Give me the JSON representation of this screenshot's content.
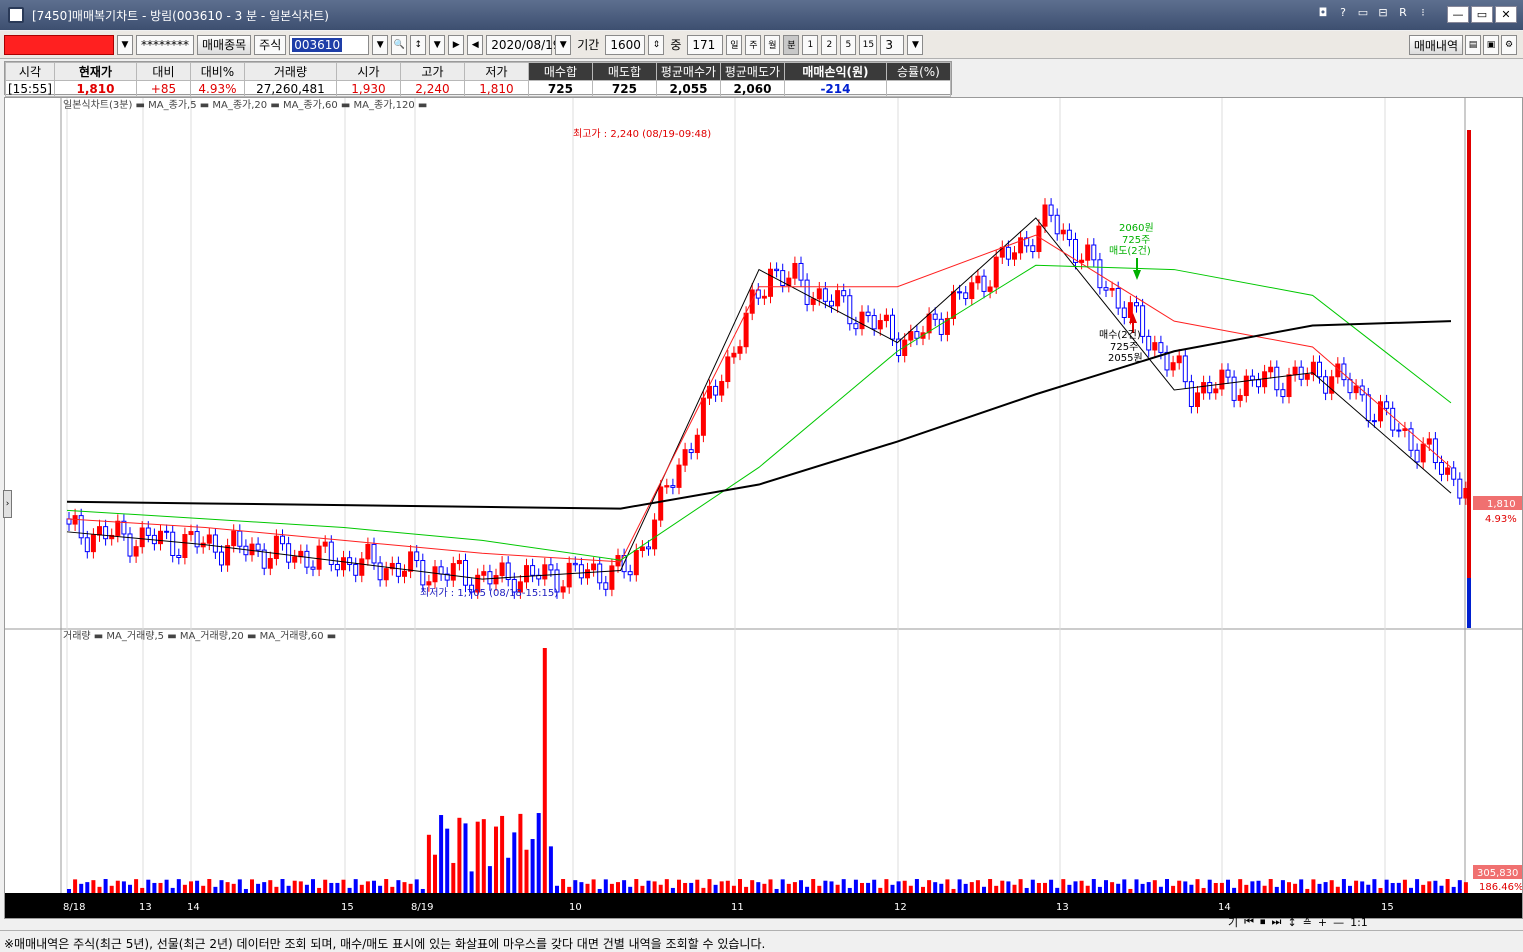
{
  "window": {
    "title": "[7450]매매복기차트 - 방림(003610 - 3 분 - 일본식차트)",
    "controls": [
      "◘",
      "?",
      "▭",
      "⊟",
      "R",
      "⁝"
    ],
    "buttons": [
      "—",
      "▭",
      "✕"
    ]
  },
  "toolbar": {
    "account_masked": "********",
    "trade_items_label": "매매종목",
    "market_label": "주식",
    "code": "003610",
    "date": "2020/08/19",
    "period_label": "기간",
    "period_value": "1600",
    "count_label": "중",
    "count_value": "171",
    "interval_buttons": [
      "일",
      "주",
      "월",
      "분",
      "1",
      "2",
      "5",
      "15"
    ],
    "selected_interval": "분",
    "minute_value": "3",
    "trade_history_label": "매매내역"
  },
  "summary": {
    "headers": [
      "시각",
      "현재가",
      "대비",
      "대비%",
      "거래량",
      "시가",
      "고가",
      "저가",
      "매수합",
      "매도합",
      "평균매수가",
      "평균매도가",
      "매매손익(원)",
      "승률(%)"
    ],
    "values": [
      "[15:55]",
      "1,810",
      "+85",
      "4.93%",
      "27,260,481",
      "1,930",
      "2,240",
      "1,810",
      "725",
      "725",
      "2,055",
      "2,060",
      "-214",
      ""
    ]
  },
  "chart": {
    "price_legend": "일본식차트(3분) ▬ MA_종가,5 ▬ MA_종가,20 ▬ MA_종가,60 ▬ MA_종가,120 ▬",
    "volume_legend": "거래량 ▬ MA_거래량,5 ▬ MA_거래량,20 ▬ MA_거래량,60 ▬",
    "high_label": "최고가 : 2,240 (08/19-09:48)",
    "low_label": "최저가 : 1,705 (08/18-15:15)",
    "buy_marker": [
      "매수(2건)",
      "725주",
      "2055원"
    ],
    "sell_marker": [
      "2060원",
      "725주",
      "매도(2건)"
    ],
    "price_tag": "1,810",
    "price_tag_pct": "4.93%",
    "volume_tag": "305,830",
    "volume_tag_pct": "186.46%",
    "x_labels": [
      "8/18",
      "13",
      "14",
      "15",
      "8/19",
      "10",
      "11",
      "12",
      "13",
      "14",
      "15"
    ],
    "colors": {
      "up": "#ff0000",
      "down": "#0000ff",
      "ma5": "#000000",
      "ma20": "#ff2020",
      "ma60": "#00c800",
      "ma120": "#000000"
    }
  },
  "chart_data": {
    "type": "candlestick",
    "title": "일본식차트(3분)",
    "x": [
      "8/18",
      "13",
      "14",
      "15",
      "8/19",
      "10",
      "11",
      "12",
      "13",
      "14",
      "15"
    ],
    "ylim": [
      1705,
      2240
    ],
    "series": [
      {
        "name": "MA_종가,5",
        "values": [
          1775,
          1760,
          1740,
          1720,
          1730,
          2080,
          1995,
          2140,
          1940,
          1960,
          1820
        ]
      },
      {
        "name": "MA_종가,20",
        "values": [
          1790,
          1780,
          1765,
          1750,
          1740,
          2060,
          2060,
          2120,
          2020,
          1990,
          1850
        ]
      },
      {
        "name": "MA_종가,60",
        "values": [
          1800,
          1790,
          1780,
          1765,
          1742,
          1850,
          1985,
          2085,
          2080,
          2050,
          1925
        ]
      },
      {
        "name": "MA_종가,120",
        "values": [
          1810,
          1808,
          1806,
          1804,
          1802,
          1830,
          1880,
          1935,
          1985,
          2015,
          2020
        ]
      }
    ],
    "volume": {
      "name": "거래량",
      "peak": 305830
    }
  },
  "status": {
    "message": "※매매내역은 주식(최근 5년), 선물(최근 2년) 데이터만 조회 되며, 매수/매도 표시에 있는 화살표에 마우스를 갖다 대면 건별 내역을 조회할 수 있습니다."
  },
  "navbar": {
    "items": [
      "기",
      "⏮",
      "⏹",
      "⏭",
      "↕",
      "≙",
      "+",
      "—",
      "1:1"
    ]
  }
}
